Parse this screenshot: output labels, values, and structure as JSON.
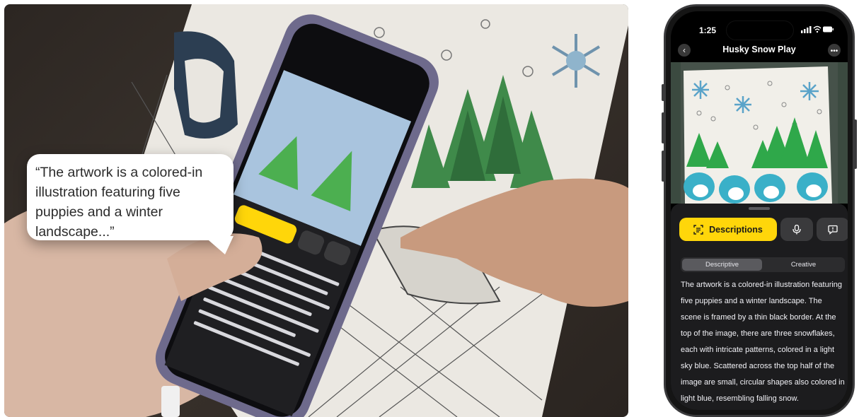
{
  "bubble": {
    "quote": "“The artwork is a colored-in illustration featuring five puppies and a winter landscape...”"
  },
  "status_bar": {
    "time": "1:25",
    "indicators": "signal, wifi, battery"
  },
  "nav": {
    "title": "Husky Snow Play",
    "back_icon": "chevron-left-icon",
    "more_icon": "ellipsis-icon"
  },
  "actions": {
    "descriptions_label": "Descriptions",
    "descriptions_icon": "scan-text-icon",
    "mic_icon": "microphone-icon",
    "chat_icon": "chat-bubble-icon"
  },
  "segmented": {
    "options": [
      "Descriptive",
      "Creative"
    ],
    "selected": "Descriptive"
  },
  "description": {
    "text": "The artwork is a colored-in illustration featuring five puppies and a winter landscape. The scene is framed by a thin black border. At the top of the image, there are three snowflakes, each with intricate patterns, colored in a light sky blue. Scattered across the top half of the image are small, circular shapes also colored in light blue, resembling falling snow."
  },
  "colors": {
    "accent": "#ffd60a",
    "sheet": "#1c1c1e",
    "segment_selected": "#5a5a5e"
  }
}
